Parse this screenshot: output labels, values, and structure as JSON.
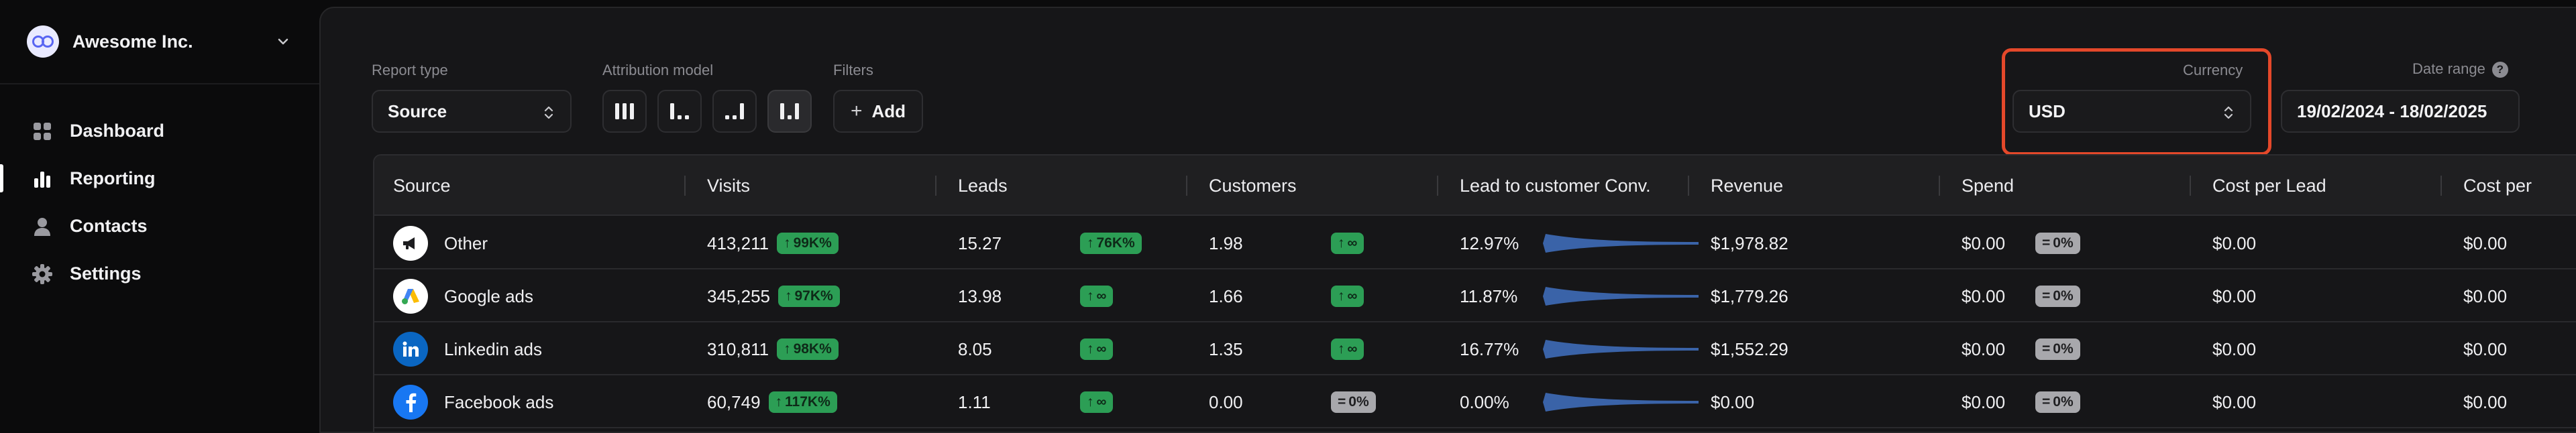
{
  "sidebar": {
    "org_name": "Awesome Inc.",
    "items": [
      {
        "label": "Dashboard",
        "icon": "dashboard-grid-icon",
        "active": false
      },
      {
        "label": "Reporting",
        "icon": "bar-chart-icon",
        "active": true
      },
      {
        "label": "Contacts",
        "icon": "person-icon",
        "active": false
      },
      {
        "label": "Settings",
        "icon": "gear-icon",
        "active": false
      }
    ]
  },
  "controls": {
    "report_type_label": "Report type",
    "report_type_value": "Source",
    "attribution_label": "Attribution model",
    "attribution_models": [
      "linear-icon",
      "first-touch-icon",
      "last-touch-icon",
      "u-shaped-icon"
    ],
    "attribution_selected_index": 3,
    "filters_label": "Filters",
    "add_label": "Add",
    "currency_label": "Currency",
    "currency_value": "USD",
    "date_range_label": "Date range",
    "date_range_value": "19/02/2024 - 18/02/2025"
  },
  "colors": {
    "accent_highlight": "#e4482a",
    "badge_green": "#2c9e55",
    "badge_gray": "#a8a8ac",
    "sparkline": "#3a63a8"
  },
  "table": {
    "columns": [
      "Source",
      "Visits",
      "Leads",
      "Customers",
      "Lead to customer Conv.",
      "Revenue",
      "Spend",
      "Cost per Lead",
      "Cost per"
    ],
    "rows": [
      {
        "source": "Other",
        "icon": "megaphone-icon",
        "visits": "413,211",
        "visits_badge": "99K%",
        "leads": "15.27",
        "leads_badge": "76K%",
        "customers": "1.98",
        "customers_badge": "∞",
        "customers_badge_type": "up",
        "conv": "12.97%",
        "revenue": "$1,978.82",
        "spend": "$0.00",
        "spend_badge": "0%",
        "cpl": "$0.00",
        "cpc": "$0.00"
      },
      {
        "source": "Google ads",
        "icon": "google-ads-icon",
        "visits": "345,255",
        "visits_badge": "97K%",
        "leads": "13.98",
        "leads_badge": "∞",
        "customers": "1.66",
        "customers_badge": "∞",
        "customers_badge_type": "up",
        "conv": "11.87%",
        "revenue": "$1,779.26",
        "spend": "$0.00",
        "spend_badge": "0%",
        "cpl": "$0.00",
        "cpc": "$0.00"
      },
      {
        "source": "Linkedin ads",
        "icon": "linkedin-icon",
        "visits": "310,811",
        "visits_badge": "98K%",
        "leads": "8.05",
        "leads_badge": "∞",
        "customers": "1.35",
        "customers_badge": "∞",
        "customers_badge_type": "up",
        "conv": "16.77%",
        "revenue": "$1,552.29",
        "spend": "$0.00",
        "spend_badge": "0%",
        "cpl": "$0.00",
        "cpc": "$0.00"
      },
      {
        "source": "Facebook ads",
        "icon": "facebook-icon",
        "visits": "60,749",
        "visits_badge": "117K%",
        "leads": "1.11",
        "leads_badge": "∞",
        "customers": "0.00",
        "customers_badge": "0%",
        "customers_badge_type": "equal",
        "conv": "0.00%",
        "revenue": "$0.00",
        "spend": "$0.00",
        "spend_badge": "0%",
        "cpl": "$0.00",
        "cpc": "$0.00"
      }
    ]
  }
}
